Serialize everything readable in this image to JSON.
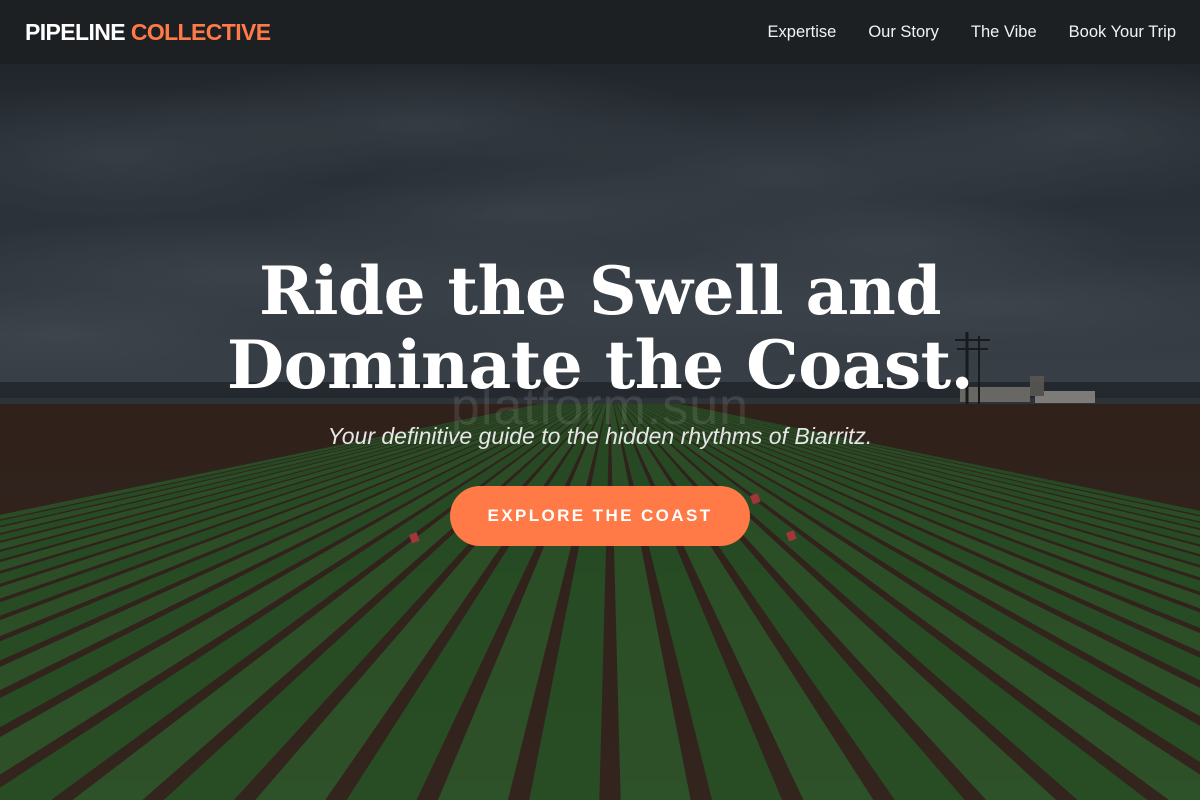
{
  "nav": {
    "logo_primary": "PIPELINE",
    "logo_accent": "COLLECTIVE",
    "links": [
      {
        "label": "Expertise"
      },
      {
        "label": "Our Story"
      },
      {
        "label": "The Vibe"
      },
      {
        "label": "Book Your Trip"
      }
    ]
  },
  "hero": {
    "headline_line1": "Ride the Swell and",
    "headline_line2": "Dominate the Coast.",
    "subtitle": "Your definitive guide to the hidden rhythms of Biarritz.",
    "watermark": "platform.sun",
    "cta_label": "EXPLORE THE COAST",
    "background_image": "lettuce-field-under-stormy-sky"
  },
  "colors": {
    "accent": "#ff7a47",
    "nav_bg": "#1d2023",
    "text": "#ffffff"
  }
}
